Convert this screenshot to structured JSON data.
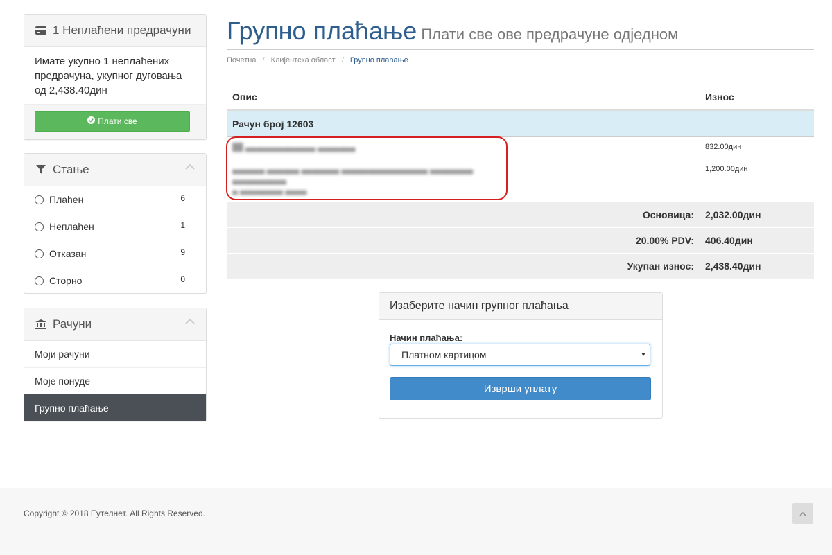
{
  "unpaid_panel": {
    "title": "1 Неплаћени предрачуни",
    "message": "Имате укупно 1 неплаћених предрачуна, укупног дуговања од 2,438.40дин",
    "pay_all_label": "Плати све"
  },
  "status_panel": {
    "title": "Стање",
    "items": [
      {
        "label": "Плаћен",
        "count": "6"
      },
      {
        "label": "Неплаћен",
        "count": "1"
      },
      {
        "label": "Отказан",
        "count": "9"
      },
      {
        "label": "Сторно",
        "count": "0"
      }
    ]
  },
  "invoices_panel": {
    "title": "Рачуни",
    "items": [
      {
        "label": "Моји рачуни"
      },
      {
        "label": "Моје понуде"
      },
      {
        "label": "Групно плаћање"
      }
    ]
  },
  "page": {
    "title": "Групно плаћање",
    "subtitle": "Плати све ове предрачуне одједном"
  },
  "breadcrumb": [
    "Почетна",
    "Клијентска област",
    "Групно плаћање"
  ],
  "table": {
    "col_description": "Опис",
    "col_amount": "Износ",
    "group_label": "Рачун број 12603",
    "items": [
      {
        "amount": "832.00дин"
      },
      {
        "amount": "1,200.00дин"
      }
    ],
    "subtotal_label": "Основица:",
    "subtotal_value": "2,032.00дин",
    "tax_label": "20.00% PDV:",
    "tax_value": "406.40дин",
    "total_label": "Укупан износ:",
    "total_value": "2,438.40дин"
  },
  "payment": {
    "heading": "Изаберите начин групног плаћања",
    "method_label": "Начин плаћања:",
    "method_selected": "Платном картицом",
    "submit_label": "Изврши уплату"
  },
  "footer": {
    "copyright": "Copyright © 2018 Еутелнет. All Rights Reserved."
  },
  "colors": {
    "accent_blue": "#2e5e8e",
    "button_blue": "#428bca",
    "button_green": "#5cb85c",
    "active_item": "#4a5055",
    "highlight_red": "#d62020"
  }
}
